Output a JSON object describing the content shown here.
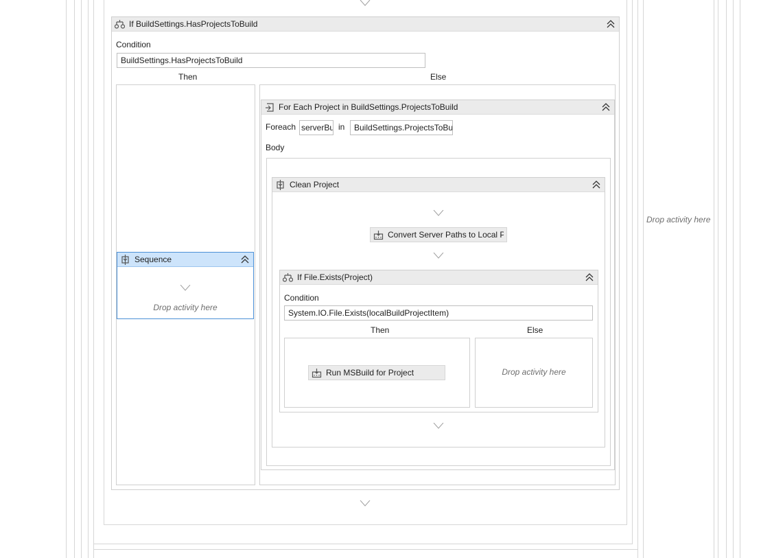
{
  "if_build": {
    "title": "If BuildSettings.HasProjectsToBuild",
    "condition_label": "Condition",
    "condition_value": "BuildSettings.HasProjectsToBuild",
    "then_label": "Then",
    "else_label": "Else"
  },
  "sequence": {
    "title": "Sequence",
    "drop_text": "Drop activity here"
  },
  "foreach": {
    "title": "For Each Project in BuildSettings.ProjectsToBuild",
    "foreach_label": "Foreach",
    "item_value": "serverBuildProjectItem",
    "in_label": "in",
    "collection_value": "BuildSettings.ProjectsToBuild",
    "body_label": "Body"
  },
  "clean_project": {
    "title": "Clean Project",
    "convert_activity": "Convert Server Paths to Local Paths"
  },
  "if_file": {
    "title": "If File.Exists(Project)",
    "condition_label": "Condition",
    "condition_value": "System.IO.File.Exists(localBuildProjectItem)",
    "then_label": "Then",
    "else_label": "Else",
    "msbuild_activity": "Run MSBuild for Project",
    "else_drop_text": "Drop activity here"
  },
  "outer_drop_text": "Drop activity here"
}
